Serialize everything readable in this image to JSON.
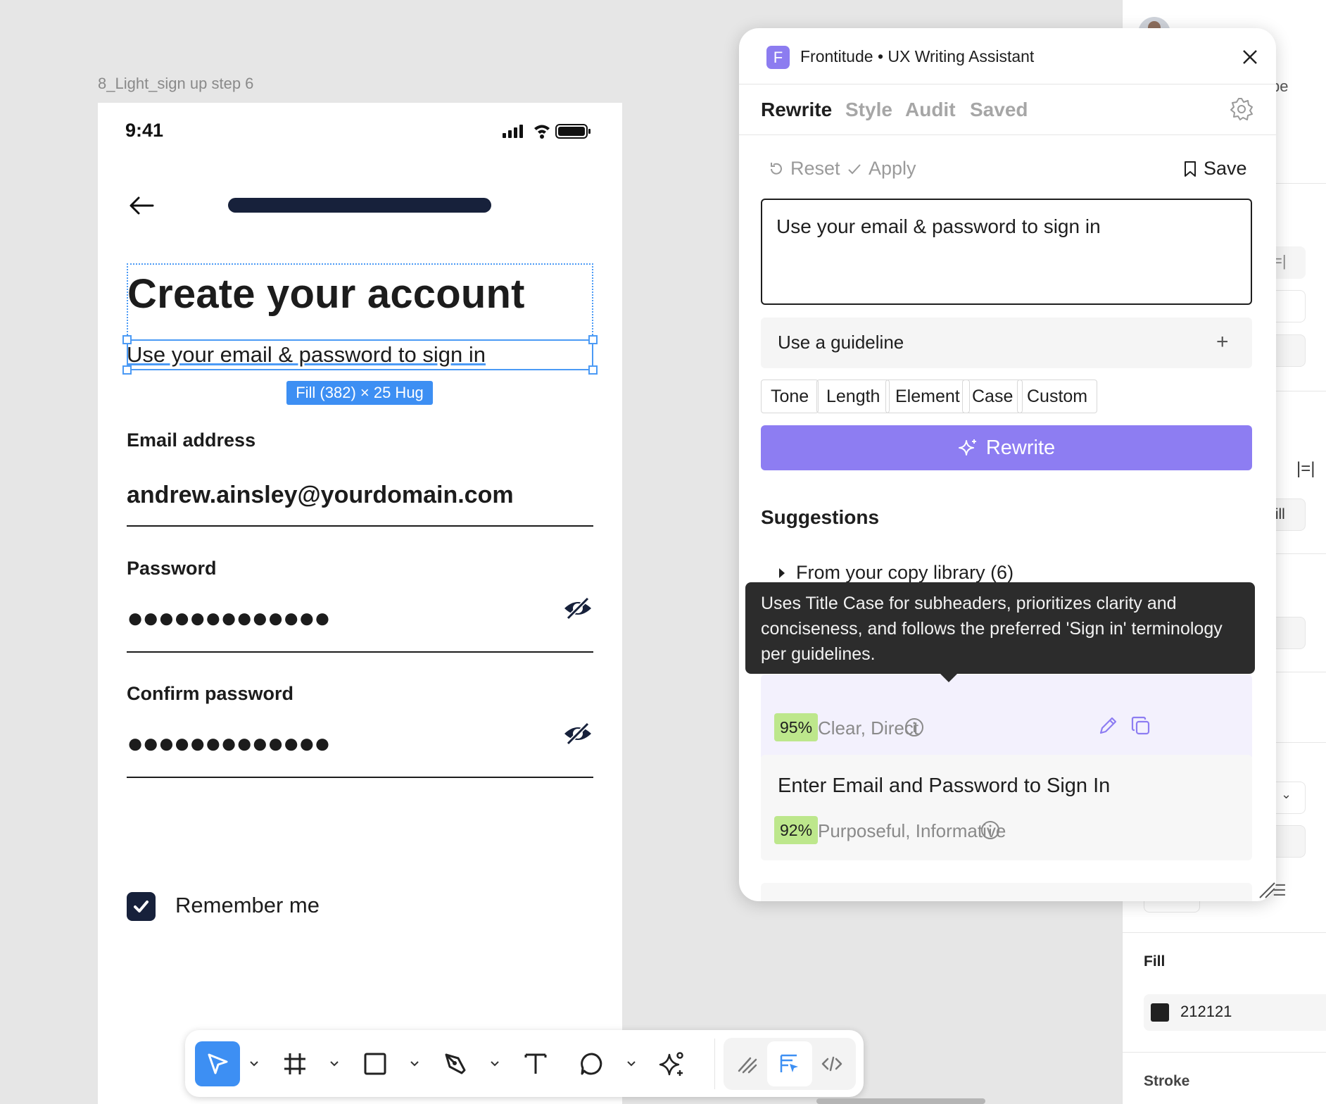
{
  "canvas": {
    "frame_label": "8_Light_sign up step 6"
  },
  "phone": {
    "status_time": "9:41",
    "title": "Create your account",
    "subtitle": "Use your email & password to sign in",
    "size_badge": "Fill (382) × 25 Hug",
    "email_label": "Email address",
    "email_value": "andrew.ainsley@yourdomain.com",
    "password_label": "Password",
    "password_dots": "●●●●●●●●●●●●●",
    "confirm_label": "Confirm password",
    "confirm_dots": "●●●●●●●●●●●●●",
    "remember_label": "Remember me",
    "remember_checked": true,
    "progress_fill": 1.0,
    "colors": {
      "dark": "#17213b",
      "selection": "#4b9af5"
    }
  },
  "toolbar": {
    "tools": [
      {
        "name": "move-tool",
        "icon": "cursor-icon",
        "active": true
      },
      {
        "name": "frame-tool",
        "icon": "hash-frame-icon"
      },
      {
        "name": "rectangle-tool",
        "icon": "square-icon"
      },
      {
        "name": "pen-tool",
        "icon": "pen-icon"
      },
      {
        "name": "text-tool",
        "icon": "text-icon"
      },
      {
        "name": "comment-tool",
        "icon": "comment-icon"
      },
      {
        "name": "actions-tool",
        "icon": "sparkle-icon"
      }
    ],
    "modes": [
      {
        "name": "draw-mode",
        "icon": "scribble-icon"
      },
      {
        "name": "design-mode",
        "icon": "design-icon",
        "active": true
      },
      {
        "name": "dev-mode",
        "icon": "code-icon"
      }
    ],
    "active_color": "#3d8ff3"
  },
  "plugin": {
    "logo_letter": "F",
    "title": "Frontitude • UX Writing Assistant",
    "tabs": [
      "Rewrite",
      "Style",
      "Audit",
      "Saved"
    ],
    "active_tab": "Rewrite",
    "reset_label": "Reset",
    "apply_label": "Apply",
    "save_label": "Save",
    "input_text": "Use your email & password to sign in",
    "guideline_label": "Use a guideline",
    "chips": [
      "Tone",
      "Length",
      "Element",
      "Case",
      "Custom"
    ],
    "rewrite_button": "Rewrite",
    "suggestions_title": "Suggestions",
    "library_label": "From your copy library (6)",
    "tooltip": "Uses Title Case for subheaders, prioritizes clarity and conciseness, and follows the preferred 'Sign in' terminology per guidelines.",
    "suggestions": [
      {
        "text": "",
        "score": "95%",
        "tags": "Clear, Direct"
      },
      {
        "text": "Enter Email and Password to Sign In",
        "score": "92%",
        "tags": "Purposeful, Informative"
      }
    ],
    "accent": "#8d7df2",
    "score_bg": "#bde78c"
  },
  "right_panel": {
    "partial_text_type": "ype",
    "fill_chip": "Fill",
    "fill_label": "Fill",
    "fill_value": "212121",
    "stroke_label": "Stroke"
  }
}
